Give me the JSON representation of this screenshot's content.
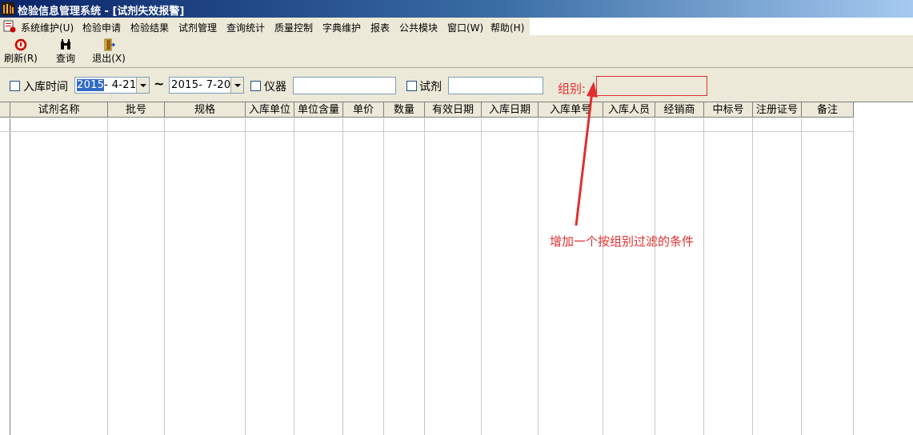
{
  "window": {
    "title": "检验信息管理系统 - [试剂失效报警]",
    "accent": "#0a246a"
  },
  "menu": {
    "items": [
      "系统维护(U)",
      "检验申请",
      "检验结果",
      "试剂管理",
      "查询统计",
      "质量控制",
      "字典维护",
      "报表",
      "公共模块",
      "窗口(W)",
      "帮助(H)"
    ]
  },
  "toolbar": {
    "refresh_label": "刷新(R)",
    "query_label": "查询",
    "exit_label": "退出(X)"
  },
  "filters": {
    "intake_time_label": "入库时间",
    "date_from_year": "2015",
    "date_from_rest": "- 4-21",
    "date_to": "2015- 7-20",
    "range_separator": "~",
    "instrument_label": "仪器",
    "instrument_value": "",
    "reagent_label": "试剂",
    "reagent_value": "",
    "group_label": "组别:",
    "group_value": ""
  },
  "table": {
    "columns": [
      "试剂名称",
      "批号",
      "规格",
      "入库单位",
      "单位含量",
      "单价",
      "数量",
      "有效日期",
      "入库日期",
      "入库单号",
      "入库人员",
      "经销商",
      "中标号",
      "注册证号",
      "备注"
    ],
    "rows": []
  },
  "annotation": {
    "text": "增加一个按组别过滤的条件",
    "color": "#e03030"
  }
}
